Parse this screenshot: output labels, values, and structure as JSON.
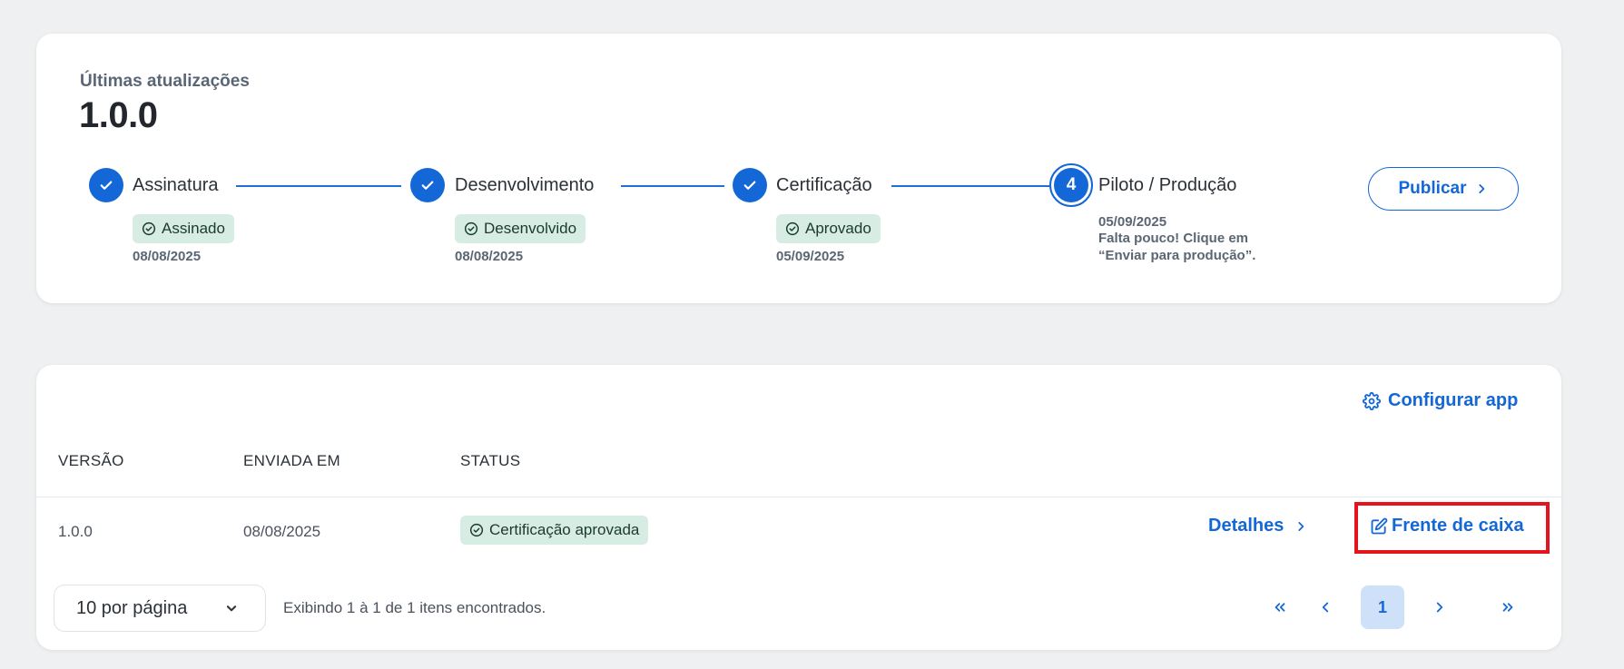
{
  "updates": {
    "label": "Últimas atualizações",
    "version": "1.0.0",
    "steps": [
      {
        "title": "Assinatura",
        "badge": "Assinado",
        "date": "08/08/2025"
      },
      {
        "title": "Desenvolvimento",
        "badge": "Desenvolvido",
        "date": "08/08/2025"
      },
      {
        "title": "Certificação",
        "badge": "Aprovado",
        "date": "05/09/2025"
      },
      {
        "number": "4",
        "title": "Piloto / Produção",
        "date": "05/09/2025",
        "note_line1": "Falta pouco! Clique em",
        "note_line2": "“Enviar para produção”."
      }
    ],
    "publish_label": "Publicar"
  },
  "versions": {
    "config_label": "Configurar app",
    "headers": {
      "version": "VERSÃO",
      "sent_at": "ENVIADA EM",
      "status": "STATUS"
    },
    "rows": [
      {
        "version": "1.0.0",
        "sent_at": "08/08/2025",
        "status": "Certificação aprovada",
        "details_label": "Detalhes",
        "action_label": "Frente de caixa"
      }
    ]
  },
  "pagination": {
    "per_page": "10 por página",
    "showing": "Exibindo 1 à 1 de 1 itens encontrados.",
    "current_page": "1"
  },
  "colors": {
    "accent": "#1367d6",
    "badge_bg": "#d7ede4",
    "highlight": "#e5131d",
    "page_bg": "#eff0f1"
  }
}
